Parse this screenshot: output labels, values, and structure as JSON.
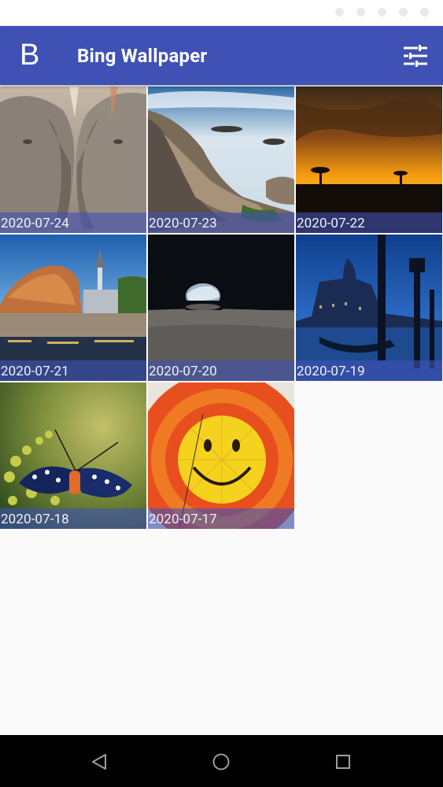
{
  "app": {
    "logo_letter": "B",
    "title": "Bing Wallpaper",
    "bar_color": "#3f51b5"
  },
  "toolbar": {
    "settings_icon": "tune-icon"
  },
  "wallpapers": [
    {
      "date": "2020-07-24",
      "subject": "elephants"
    },
    {
      "date": "2020-07-23",
      "subject": "rocky coast"
    },
    {
      "date": "2020-07-22",
      "subject": "savanna sunset"
    },
    {
      "date": "2020-07-21",
      "subject": "riverside town"
    },
    {
      "date": "2020-07-20",
      "subject": "earthrise"
    },
    {
      "date": "2020-07-19",
      "subject": "venice at night"
    },
    {
      "date": "2020-07-18",
      "subject": "moth on plant"
    },
    {
      "date": "2020-07-17",
      "subject": "smiley hot-air balloon"
    }
  ],
  "system_nav": {
    "back_icon": "back-triangle-icon",
    "home_icon": "home-circle-icon",
    "recents_icon": "recents-square-icon"
  }
}
